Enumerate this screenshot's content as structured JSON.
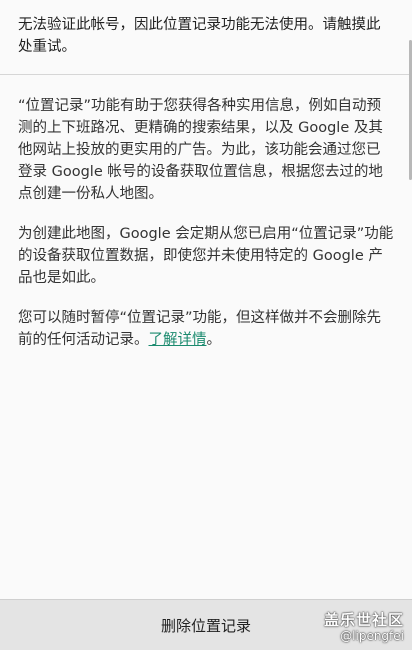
{
  "error": {
    "message": "无法验证此帐号，因此位置记录功能无法使用。请触摸此处重试。"
  },
  "info": {
    "paragraph1": "“位置记录”功能有助于您获得各种实用信息，例如自动预测的上下班路况、更精确的搜索结果，以及 Google 及其他网站上投放的更实用的广告。为此，该功能会通过您已登录 Google 帐号的设备获取位置信息，根据您去过的地点创建一份私人地图。",
    "paragraph2": "为创建此地图，Google 会定期从您已启用“位置记录”功能的设备获取位置数据，即使您并未使用特定的 Google 产品也是如此。",
    "paragraph3_text": "您可以随时暂停“位置记录”功能，但这样做并不会删除先前的任何活动记录。",
    "learn_more_label": "了解详情",
    "paragraph3_end": "。"
  },
  "bottom_bar": {
    "delete_label": "删除位置记录"
  },
  "watermark": {
    "title": "盖乐世社区",
    "user": "@lipengfei"
  },
  "colors": {
    "link": "#1a8a6e",
    "background": "#fafafa",
    "bottom_bar": "#e4e4e4"
  }
}
